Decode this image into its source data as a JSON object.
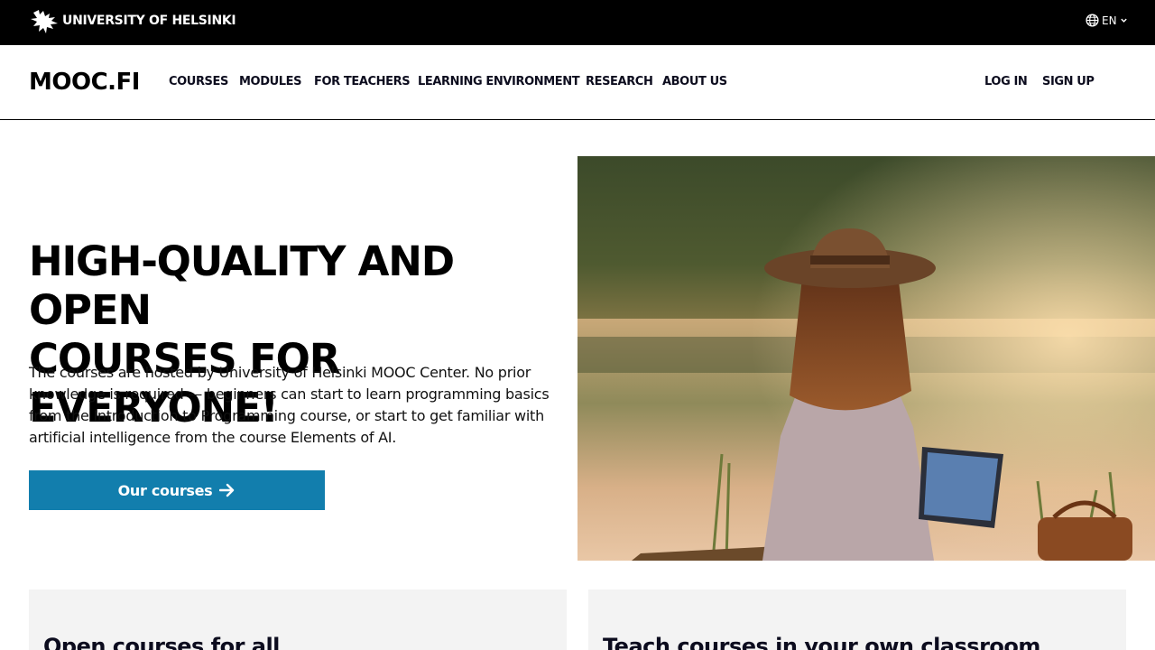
{
  "top_bar": {
    "university_name": "UNIVERSITY OF HELSINKI",
    "language": "EN",
    "icons": [
      "helsinki-logo-icon",
      "globe-icon",
      "chevron-down-icon"
    ]
  },
  "nav": {
    "brand": "MOOC.FI",
    "items": [
      {
        "label": "COURSES"
      },
      {
        "label": "MODULES"
      },
      {
        "label": "FOR TEACHERS"
      },
      {
        "label": "LEARNING ENVIRONMENT"
      },
      {
        "label": "RESEARCH"
      },
      {
        "label": "ABOUT US"
      }
    ],
    "login": "LOG IN",
    "signup": "SIGN UP"
  },
  "hero": {
    "title_line1": "HIGH-QUALITY AND OPEN",
    "title_line2": "COURSES FOR EVERYONE!",
    "description": "The courses are hosted by University of Helsinki MOOC Center. No prior knowledge is required — beginners can start to learn programming basics from the Introduction to Programming course, or start to get familiar with artificial intelligence from the course Elements of AI.",
    "cta_label": "Our courses",
    "cta_icon": "arrow-right-icon"
  },
  "cards": [
    {
      "title": "Open courses for all"
    },
    {
      "title": "Teach courses in your own classroom"
    }
  ],
  "colors": {
    "top_bar": "#000000",
    "cta": "#127ead",
    "card_bg": "#f3f3f3",
    "text": "#0c0c1e"
  }
}
